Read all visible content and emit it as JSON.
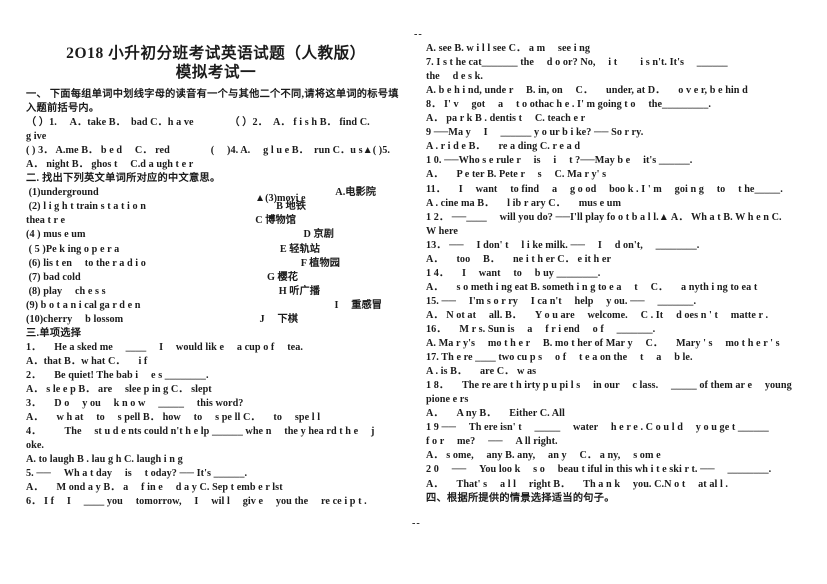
{
  "document": {
    "title_main": "2O18 小升初分班考试英语试题（人教版）",
    "title_sub": "模拟考试一",
    "top_marker": "--",
    "bottom_marker": "--"
  },
  "left_column": {
    "section_one": {
      "heading_line1": "一、 下面每组单词中划线字母的读音有一个与其他二个不同,请将这单词的标号填",
      "heading_line2": "入题前括号内。",
      "items_line1": "（ ）1. 　A．take B．　bad C．h a ve　　　　（ ）2．　A． f i s h B． find C.",
      "items_line2": "g ive",
      "items_line3": "( ) 3． A.me B． b e d 　C． red　　　　( 　)4. A.　 g l u e B．　run C．u s▲( )5.",
      "items_line4": "A． night B． ghos t 　C.d a ugh t e r"
    },
    "section_two": {
      "heading": "二. 找出下列英文单词所对应的中文意思。",
      "rows": [
        {
          "en": " (1)underground",
          "cn": "A.电影院"
        },
        {
          "en": " (2) l i g h t train s t a t i o n",
          "cn": "B 地铁"
        },
        {
          "en": "thea t r e",
          "cn": "C 博物馆",
          "cn_indent": true
        },
        {
          "en": "(4 ) mus e um",
          "cn": "D 京剧"
        },
        {
          "en": " ( 5 )Pe k ing o p e r a",
          "cn": "E 轻轨站"
        },
        {
          "en": " (6) lis t en 　to the r a d i o",
          "cn": "F 植物园"
        },
        {
          "en": " (7) bad cold",
          "cn": "G 樱花"
        },
        {
          "en": " (8) play 　ch e s s",
          "cn": "H 听广播"
        },
        {
          "en": "(9) b o t a n i cal ga r d e n",
          "cn": "I 　重感冒"
        },
        {
          "en": "(10)cherry 　b lossom",
          "cn": "J 　下棋"
        }
      ],
      "floating_fragment": "▲(3)movi e"
    },
    "section_three": {
      "heading": "三.单项选择",
      "lines": [
        "1． 　He a sked me 　____ 　I 　would lik e 　a cup o f 　tea.",
        "A．that B．w hat C． 　i f",
        "2． 　Be quiet! The bab i 　e s ________.",
        "A． s le e p B． are 　slee p in g C． slept",
        "3． 　D o 　y ou 　k n o w 　_____ 　this word?",
        "A． 　w h at 　to 　s pell B． how 　to 　s pe ll C． 　to 　spe l l",
        "4． 　　The 　st u d e nts could n't h e lp ______ whe n 　the y hea rd t h e 　j",
        "oke.",
        "A. to laugh B . lau g h C. laugh i n g",
        "5. ── 　Wh a t day 　is 　t oday? ── It's ______.",
        "A． 　M ond a y B． a 　f in e 　d a y C. Sep t emb e r lst",
        "6． I f 　I 　____ you 　tomorrow, 　I 　wil l 　giv e 　you the 　re ce i p t ."
      ]
    }
  },
  "right_column": {
    "lines": [
      "A. see B. w i l l see C． a m 　see i ng",
      "7. I s t he cat_______ the 　d o or? No, 　i t 　　i s n't. It's 　______",
      "the 　d e s k.",
      "A. b e h i nd, unde r 　B. in, on 　C． 　under, at D． 　o v e r, b e hin d",
      "8． I' v 　got 　a 　t o othac h e . I' m going t o 　the_________.",
      "A． pa r k B . dentis t 　C. teach e r",
      "9 ──Ma y 　I 　______ y o ur b i ke? ── So r ry.",
      "A . r i d e B． 　re a ding C. r e a d",
      "1 0. ──Who s e rule r 　is 　i 　t ?──May b e 　it's ______.",
      "A． 　P e ter B. Pete r 　s 　C. Ma r y' s",
      "11． 　I 　want 　to find 　a 　g o od 　boo k . I ' m 　goi n g 　to 　t he_____.",
      "A . cine ma B． 　l ib r ary C． 　mus e um",
      "1 2． ──____ 　will you do? ──I'll play fo o t b a l l.▲ A． Wh a t B. W h e n C.",
      "W here",
      "13． ── 　I don' t 　l i ke milk. ── 　I 　d on't, 　________.",
      "A． 　too 　B． 　ne i t h er C． e it h er",
      "1 4． 　I 　want 　to 　b uy ________.",
      "A． 　s o meth i ng eat B. someth i n g to e a 　t 　C． 　a nyth i ng to ea t",
      "15. ── 　I'm s o r ry 　I ca n't 　help 　y ou. ── 　_______.",
      "A． N ot at 　all. B． 　Y o u are 　welcome. 　C . It 　d oes n ' t 　matte r .",
      "16． 　M r s. Sun is 　a 　f r i end 　o f 　_______.",
      "A. Ma r y's 　mo t h e r 　B. mo t her of Mar y 　C． 　Mary ' s 　mo t h e r ' s",
      "17. Th e re ____ two cu p s 　o f 　t e a on the 　t 　a 　b le.",
      "A . is B． 　are C． w as",
      "1 8． 　The re are t h irty p u pi l s 　in our 　c lass. 　_____ of them ar e 　young",
      "pione e rs",
      "A． 　A ny B． 　Either C. All",
      "1 9 ── 　Th ere isn' t 　_____ 　water 　h e r e . C o u l d 　y o u ge t ______",
      "f o r 　me? 　── 　A ll right.",
      "A． s ome, 　any B. any, 　an y 　C． a ny, 　s om e",
      "2 0 　── 　You loo k 　s o 　beau t iful in this wh i t e ski r t. ── 　________.",
      "A． 　That' s 　a l l 　right B． 　Th a n k 　you. C.N o t 　at al l .",
      "四、根据所提供的情景选择适当的句子。"
    ]
  }
}
